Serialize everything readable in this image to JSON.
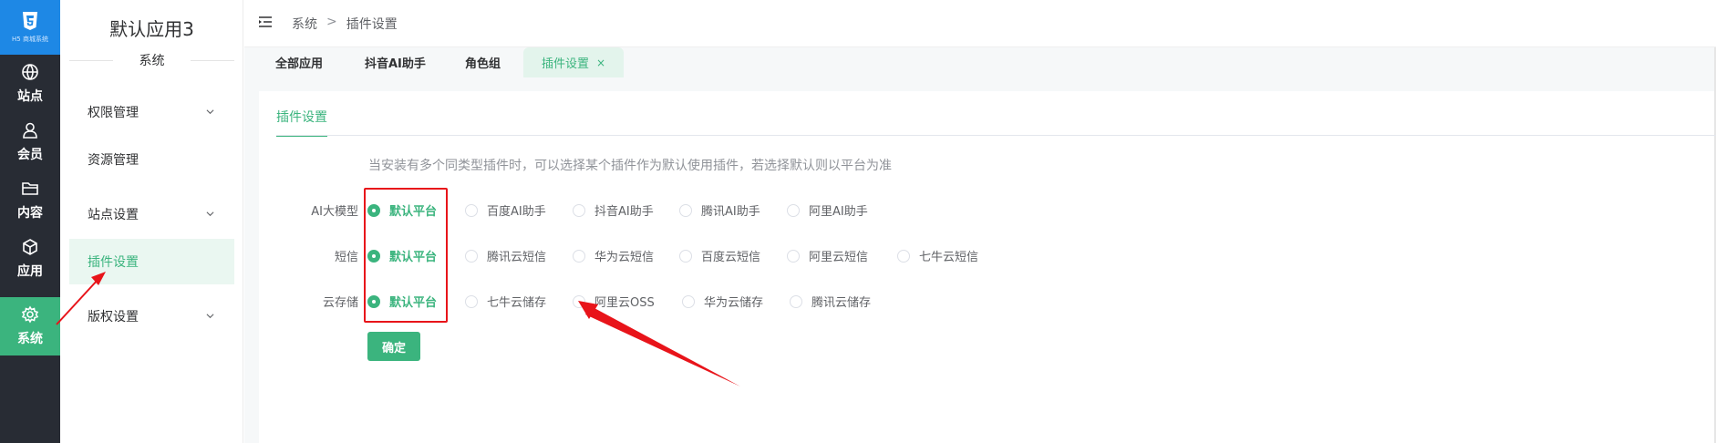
{
  "rail": {
    "logo_text": "H5 商城系统",
    "items": [
      {
        "label": "站点",
        "icon": "globe-icon"
      },
      {
        "label": "会员",
        "icon": "user-icon"
      },
      {
        "label": "内容",
        "icon": "folder-icon"
      },
      {
        "label": "应用",
        "icon": "cube-icon"
      },
      {
        "label": "系统",
        "icon": "gear-icon"
      }
    ]
  },
  "sidebar": {
    "app_name": "默认应用3",
    "group_title": "系统",
    "items": [
      {
        "label": "权限管理",
        "has_children": true
      },
      {
        "label": "资源管理",
        "has_children": false
      },
      {
        "label": "站点设置",
        "has_children": true
      },
      {
        "label": "插件设置",
        "has_children": false,
        "active": true
      },
      {
        "label": "版权设置",
        "has_children": true
      }
    ]
  },
  "breadcrumb": {
    "root": "系统",
    "separator": ">",
    "current": "插件设置"
  },
  "tabs": [
    {
      "label": "全部应用"
    },
    {
      "label": "抖音AI助手"
    },
    {
      "label": "角色组"
    },
    {
      "label": "插件设置",
      "active": true,
      "close": "×"
    }
  ],
  "content": {
    "sub_tab": "插件设置",
    "tip": "当安装有多个同类型插件时，可以选择某个插件作为默认使用插件，若选择默认则以平台为准",
    "rows": [
      {
        "label": "AI大模型",
        "options": [
          "默认平台",
          "百度AI助手",
          "抖音AI助手",
          "腾讯AI助手",
          "阿里AI助手"
        ],
        "selected": "默认平台"
      },
      {
        "label": "短信",
        "options": [
          "默认平台",
          "腾讯云短信",
          "华为云短信",
          "百度云短信",
          "阿里云短信",
          "七牛云短信"
        ],
        "selected": "默认平台"
      },
      {
        "label": "云存储",
        "options": [
          "默认平台",
          "七牛云储存",
          "阿里云OSS",
          "华为云储存",
          "腾讯云储存"
        ],
        "selected": "默认平台"
      }
    ],
    "confirm_label": "确定"
  },
  "colors": {
    "accent": "#3bb47e",
    "rail_bg": "#282c34",
    "logo_bg": "#1e88e5",
    "annotation": "#e8141a"
  }
}
